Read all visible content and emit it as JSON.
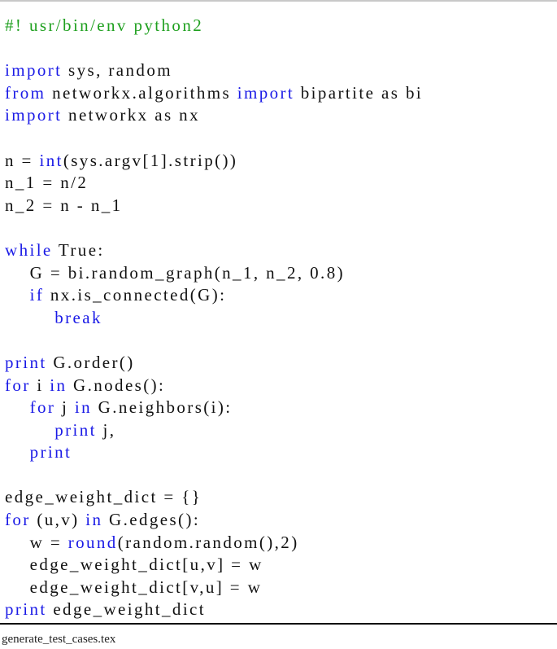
{
  "code": {
    "lines": [
      [
        {
          "t": "#! usr/bin/env python2",
          "c": "cm"
        }
      ],
      [],
      [
        {
          "t": "import",
          "c": "kw"
        },
        {
          "t": " sys, random"
        }
      ],
      [
        {
          "t": "from",
          "c": "kw"
        },
        {
          "t": " networkx.algorithms "
        },
        {
          "t": "import",
          "c": "kw"
        },
        {
          "t": " bipartite as bi"
        }
      ],
      [
        {
          "t": "import",
          "c": "kw"
        },
        {
          "t": " networkx as nx"
        }
      ],
      [],
      [
        {
          "t": "n = "
        },
        {
          "t": "int",
          "c": "kw"
        },
        {
          "t": "(sys.argv[1].strip())"
        }
      ],
      [
        {
          "t": "n_1 = n/2"
        }
      ],
      [
        {
          "t": "n_2 = n - n_1"
        }
      ],
      [],
      [
        {
          "t": "while",
          "c": "kw"
        },
        {
          "t": " True:"
        }
      ],
      [
        {
          "t": "    G = bi.random_graph(n_1, n_2, 0.8)"
        }
      ],
      [
        {
          "t": "    "
        },
        {
          "t": "if",
          "c": "kw"
        },
        {
          "t": " nx.is_connected(G):"
        }
      ],
      [
        {
          "t": "        "
        },
        {
          "t": "break",
          "c": "kw"
        }
      ],
      [],
      [
        {
          "t": "print",
          "c": "kw"
        },
        {
          "t": " G.order()"
        }
      ],
      [
        {
          "t": "for",
          "c": "kw"
        },
        {
          "t": " i "
        },
        {
          "t": "in",
          "c": "kw"
        },
        {
          "t": " G.nodes():"
        }
      ],
      [
        {
          "t": "    "
        },
        {
          "t": "for",
          "c": "kw"
        },
        {
          "t": " j "
        },
        {
          "t": "in",
          "c": "kw"
        },
        {
          "t": " G.neighbors(i):"
        }
      ],
      [
        {
          "t": "        "
        },
        {
          "t": "print",
          "c": "kw"
        },
        {
          "t": " j,"
        }
      ],
      [
        {
          "t": "    "
        },
        {
          "t": "print",
          "c": "kw"
        }
      ],
      [],
      [
        {
          "t": "edge_weight_dict = {}"
        }
      ],
      [
        {
          "t": "for",
          "c": "kw"
        },
        {
          "t": " (u,v) "
        },
        {
          "t": "in",
          "c": "kw"
        },
        {
          "t": " G.edges():"
        }
      ],
      [
        {
          "t": "    w = "
        },
        {
          "t": "round",
          "c": "kw"
        },
        {
          "t": "(random.random(),2)"
        }
      ],
      [
        {
          "t": "    edge_weight_dict[u,v] = w"
        }
      ],
      [
        {
          "t": "    edge_weight_dict[v,u] = w"
        }
      ],
      [
        {
          "t": "print",
          "c": "kw"
        },
        {
          "t": " edge_weight_dict"
        }
      ]
    ]
  },
  "caption": "generate_test_cases.tex",
  "colors": {
    "keyword": "#1a1ae6",
    "comment": "#1fa01f"
  }
}
